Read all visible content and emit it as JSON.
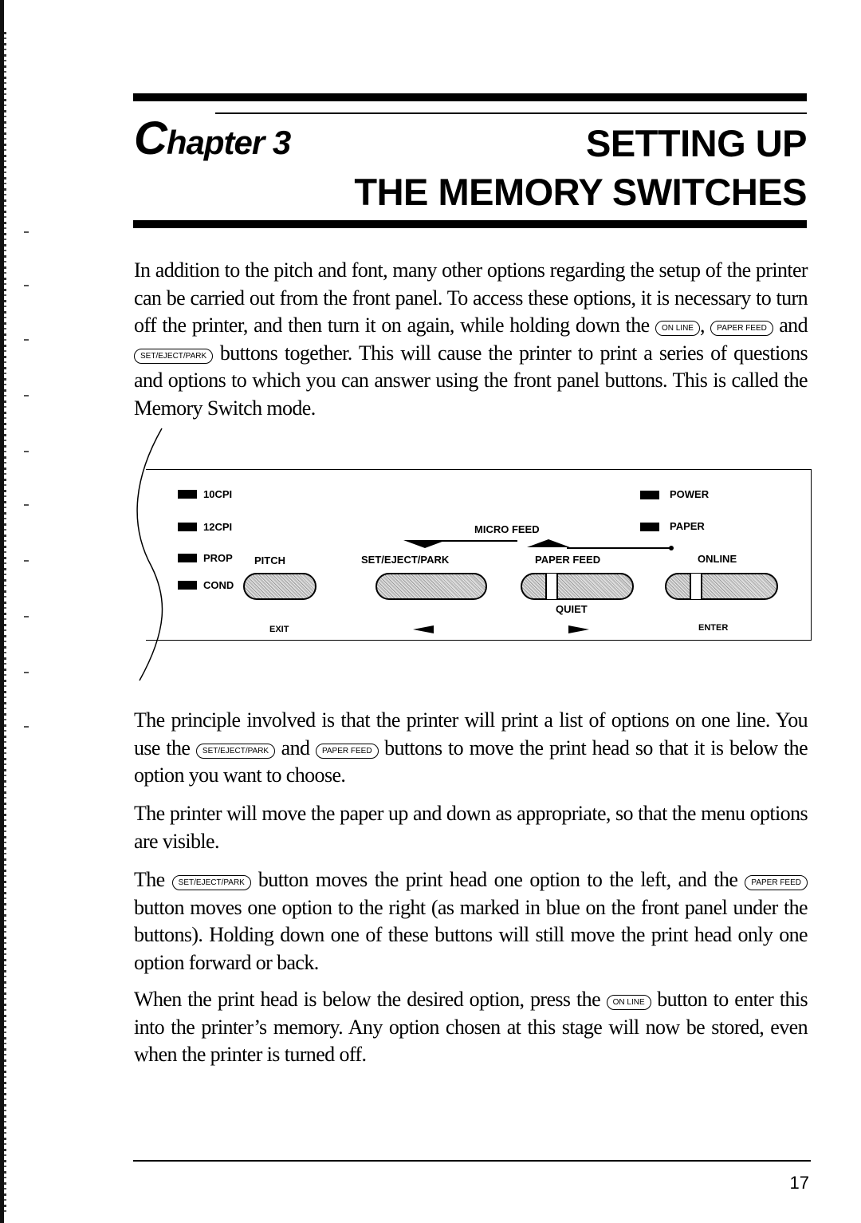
{
  "header": {
    "chapter_prefix": "C",
    "chapter_rest": "hapter 3",
    "title_line1": "SETTING UP",
    "title_line2": "THE MEMORY SWITCHES"
  },
  "paragraphs": {
    "p1": {
      "t1": "In addition to the pitch and font, many other options regarding the setup of the printer can be carried out from the front panel. To access these options, it is necessary to turn off the printer, and then turn it on again, while holding down the ",
      "b1": "ON LINE",
      "t2": ", ",
      "b2": "PAPER FEED",
      "t3": " and ",
      "b3": "SET/EJECT/PARK",
      "t4": " buttons together. This will cause the printer to print a series of questions and options to which you can answer using the front panel buttons. This is called the Memory Switch mode."
    },
    "p2": {
      "t1": "The principle involved is that the printer will print a list of options on one line. You use the ",
      "b1": "SET/EJECT/PARK",
      "t2": " and ",
      "b2": "PAPER FEED",
      "t3": " buttons to move the print head so that it is below the option you want to choose."
    },
    "p3": {
      "t1": "The printer will move the paper up and down as appropriate, so that the menu options are visible."
    },
    "p4": {
      "t1": "The ",
      "b1": "SET/EJECT/PARK",
      "t2": " button moves the print head one option to the left, and the ",
      "b2": "PAPER FEED",
      "t3": " button moves one option to the right (as marked in blue on the front panel under the buttons). Holding down one of these buttons will still move the print head only one option forward or back."
    },
    "p5": {
      "t1": "When the print head is below the desired option, press the ",
      "b1": "ON LINE",
      "t2": " button to enter this into the printer’s memory. Any option chosen at this stage will now be stored, even when the printer is turned off."
    }
  },
  "diagram": {
    "leds_left": [
      "10CPI",
      "12CPI",
      "PROP",
      "COND"
    ],
    "leds_right": [
      "POWER",
      "PAPER"
    ],
    "pitch_label": "PITCH",
    "exit_label": "EXIT",
    "micro_feed_label": "MICRO FEED",
    "set_eject_park_label": "SET/EJECT/PARK",
    "paper_feed_label": "PAPER FEED",
    "quiet_label": "QUIET",
    "online_label": "ONLINE",
    "enter_label": "ENTER"
  },
  "footer": {
    "page_number": "17"
  }
}
